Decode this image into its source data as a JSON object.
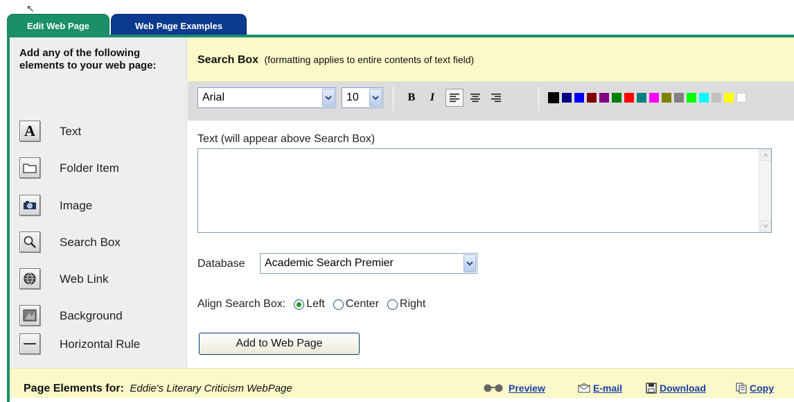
{
  "tabs": [
    {
      "label": "Edit Web Page",
      "active": true
    },
    {
      "label": "Web Page Examples",
      "active": false
    }
  ],
  "sidebar": {
    "heading": "Add any of the following elements to your web page:",
    "items": [
      {
        "label": "Text",
        "icon": "text-icon"
      },
      {
        "label": "Folder Item",
        "icon": "folder-icon"
      },
      {
        "label": "Image",
        "icon": "camera-icon"
      },
      {
        "label": "Search Box",
        "icon": "magnifier-icon"
      },
      {
        "label": "Web Link",
        "icon": "globe-icon"
      },
      {
        "label": "Background",
        "icon": "background-icon"
      },
      {
        "label": "Horizontal Rule",
        "icon": "horizontal-rule-icon"
      }
    ]
  },
  "editor": {
    "title": "Search Box",
    "title_note": "(formatting applies to entire contents of text field)",
    "font_value": "Arial",
    "size_value": "10",
    "text_label": "Text (will appear above Search Box)",
    "text_value": "",
    "database_label": "Database",
    "database_value": "Academic Search Premier",
    "align_label": "Align Search Box:",
    "align_options": [
      "Left",
      "Center",
      "Right"
    ],
    "align_selected": "Left",
    "add_button": "Add to Web Page"
  },
  "colors": {
    "swatches": [
      "#000000",
      "#000080",
      "#0000ff",
      "#800000",
      "#800080",
      "#008000",
      "#ff0000",
      "#008080",
      "#ff00ff",
      "#808000",
      "#808080",
      "#00ff00",
      "#00ffff",
      "#c0c0c0",
      "#ffff00",
      "#ffffff"
    ],
    "tab_active": "#1a8f6a",
    "tab_inactive": "#0c3a8e",
    "header_bg": "#fbf8c9"
  },
  "footer": {
    "label": "Page Elements for:",
    "page_name": "Eddie's Literary Criticism WebPage",
    "actions": [
      "Preview",
      "E-mail",
      "Download",
      "Copy"
    ]
  }
}
